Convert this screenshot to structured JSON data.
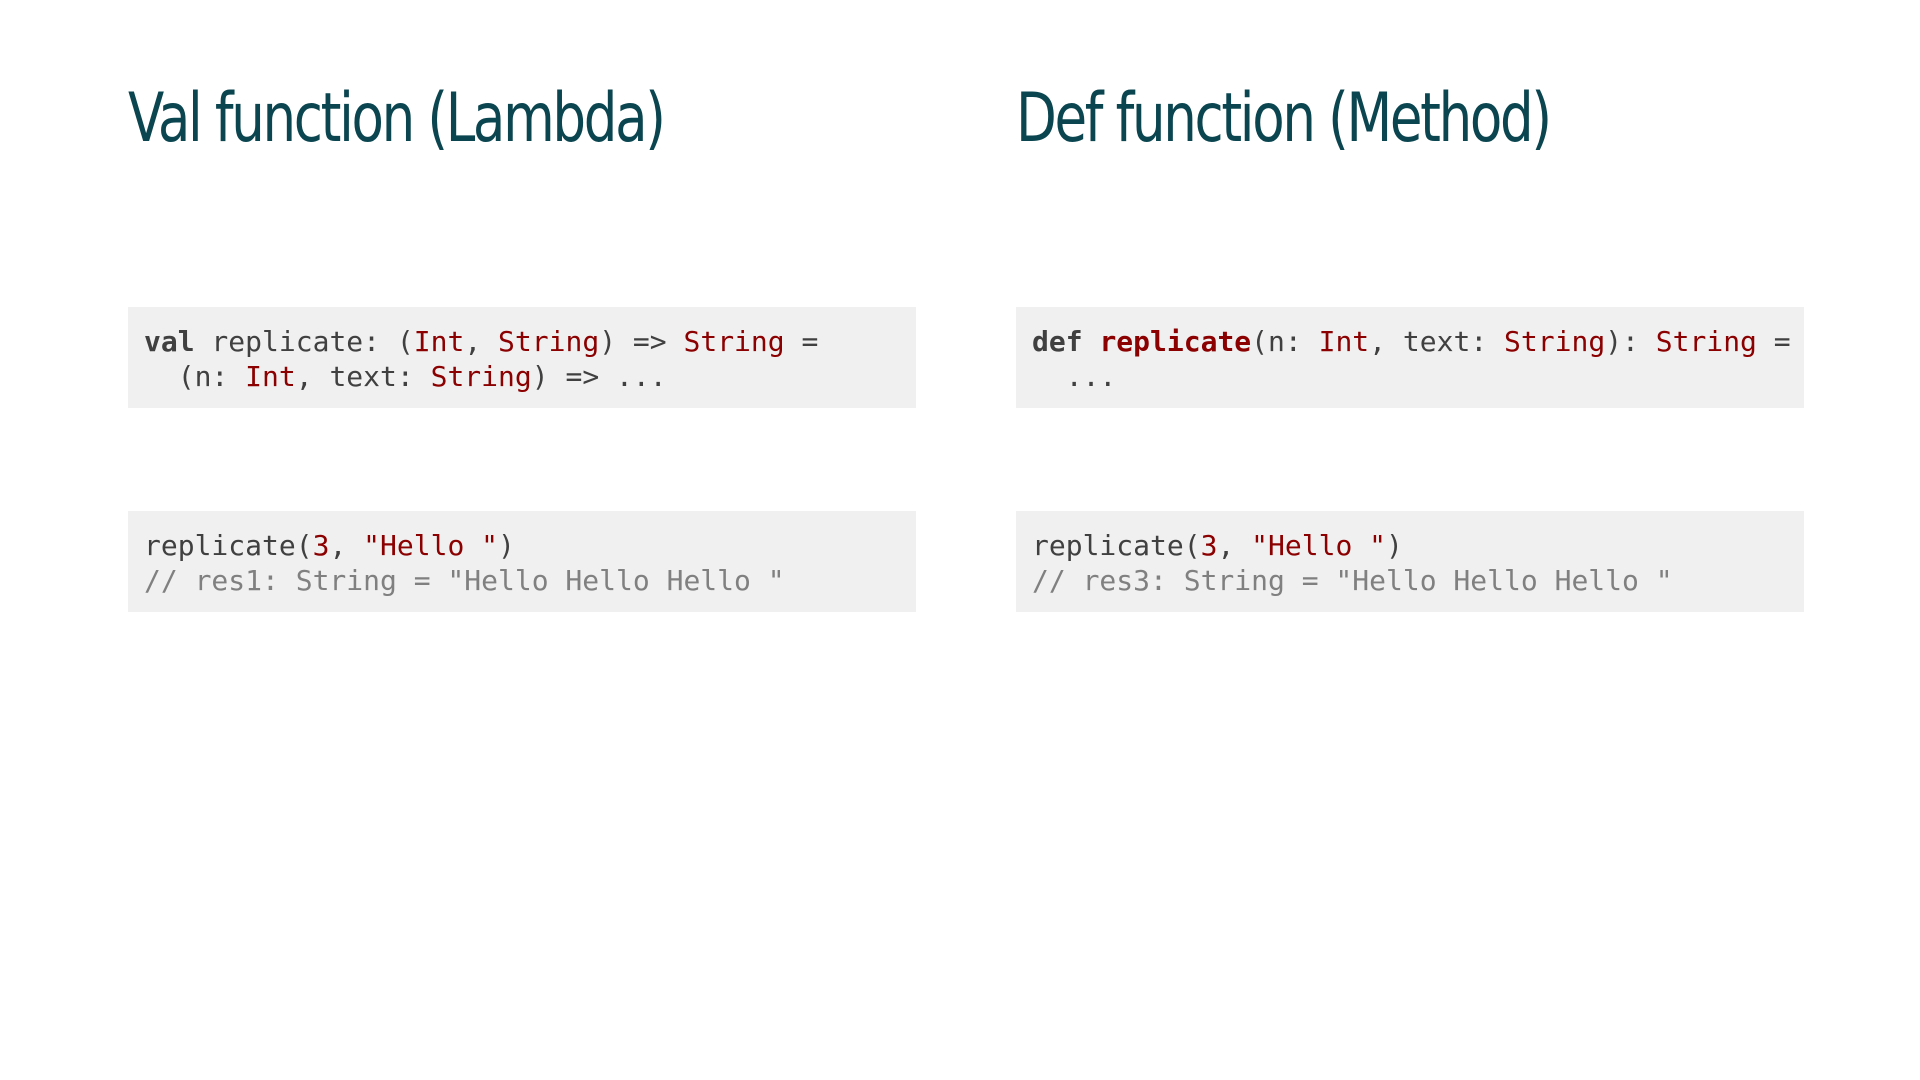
{
  "left": {
    "title": "Val function (Lambda)",
    "definition": {
      "line1": [
        {
          "t": "val",
          "c": "kw"
        },
        {
          "t": " replicate: (",
          "c": "plain"
        },
        {
          "t": "Int",
          "c": "type"
        },
        {
          "t": ", ",
          "c": "plain"
        },
        {
          "t": "String",
          "c": "type"
        },
        {
          "t": ") => ",
          "c": "plain"
        },
        {
          "t": "String",
          "c": "type"
        },
        {
          "t": " =",
          "c": "plain"
        }
      ],
      "line2": [
        {
          "t": "  (n: ",
          "c": "plain"
        },
        {
          "t": "Int",
          "c": "type"
        },
        {
          "t": ", text: ",
          "c": "plain"
        },
        {
          "t": "String",
          "c": "type"
        },
        {
          "t": ") => ...",
          "c": "plain"
        }
      ]
    },
    "call": {
      "line1": [
        {
          "t": "replicate(",
          "c": "plain"
        },
        {
          "t": "3",
          "c": "num"
        },
        {
          "t": ", ",
          "c": "plain"
        },
        {
          "t": "\"Hello \"",
          "c": "str"
        },
        {
          "t": ")",
          "c": "plain"
        }
      ],
      "line2": [
        {
          "t": "// res1: String = \"Hello Hello Hello \"",
          "c": "comment"
        }
      ]
    }
  },
  "right": {
    "title": "Def function (Method)",
    "definition": {
      "line1": [
        {
          "t": "def",
          "c": "kw"
        },
        {
          "t": " ",
          "c": "plain"
        },
        {
          "t": "replicate",
          "c": "fn"
        },
        {
          "t": "(n: ",
          "c": "plain"
        },
        {
          "t": "Int",
          "c": "type"
        },
        {
          "t": ", text: ",
          "c": "plain"
        },
        {
          "t": "String",
          "c": "type"
        },
        {
          "t": "): ",
          "c": "plain"
        },
        {
          "t": "String",
          "c": "type"
        },
        {
          "t": " =",
          "c": "plain"
        }
      ],
      "line2": [
        {
          "t": "  ...",
          "c": "plain"
        }
      ]
    },
    "call": {
      "line1": [
        {
          "t": "replicate(",
          "c": "plain"
        },
        {
          "t": "3",
          "c": "num"
        },
        {
          "t": ", ",
          "c": "plain"
        },
        {
          "t": "\"Hello \"",
          "c": "str"
        },
        {
          "t": ")",
          "c": "plain"
        }
      ],
      "line2": [
        {
          "t": "// res3: String = \"Hello Hello Hello \"",
          "c": "comment"
        }
      ]
    }
  }
}
